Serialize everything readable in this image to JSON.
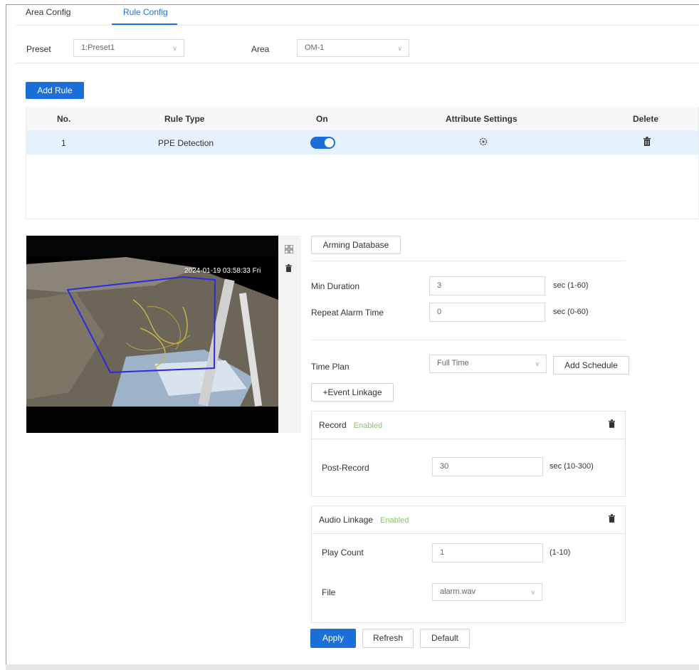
{
  "tabs": [
    {
      "label": "Area Config",
      "active": false
    },
    {
      "label": "Rule Config",
      "active": true
    }
  ],
  "filters": {
    "preset_label": "Preset",
    "preset_value": "1:Preset1",
    "area_label": "Area",
    "area_value": "OM-1"
  },
  "add_rule_label": "Add Rule",
  "table": {
    "headers": [
      "No.",
      "Rule Type",
      "On",
      "Attribute Settings",
      "Delete"
    ],
    "rows": [
      {
        "no": "1",
        "rule_type": "PPE Detection",
        "on": true
      }
    ]
  },
  "video": {
    "timestamp": "2024-01-19 03:58:33 Fri"
  },
  "form": {
    "arming_database_label": "Arming Database",
    "min_duration_label": "Min Duration",
    "min_duration_value": "3",
    "min_duration_unit": "sec (1-60)",
    "repeat_alarm_label": "Repeat Alarm Time",
    "repeat_alarm_value": "0",
    "repeat_alarm_unit": "sec (0-60)",
    "time_plan_label": "Time Plan",
    "time_plan_value": "Full Time",
    "add_schedule_label": "Add Schedule",
    "event_linkage_label": "+Event Linkage"
  },
  "record_panel": {
    "title": "Record",
    "status": "Enabled",
    "post_record_label": "Post-Record",
    "post_record_value": "30",
    "post_record_unit": "sec (10-300)"
  },
  "audio_panel": {
    "title": "Audio Linkage",
    "status": "Enabled",
    "play_count_label": "Play Count",
    "play_count_value": "1",
    "play_count_unit": "(1-10)",
    "file_label": "File",
    "file_value": "alarm.wav"
  },
  "buttons": {
    "apply": "Apply",
    "refresh": "Refresh",
    "default": "Default"
  },
  "colors": {
    "accent": "#1d6fd8",
    "enabled": "#8cc665",
    "selected_row": "#e5f1fc"
  }
}
